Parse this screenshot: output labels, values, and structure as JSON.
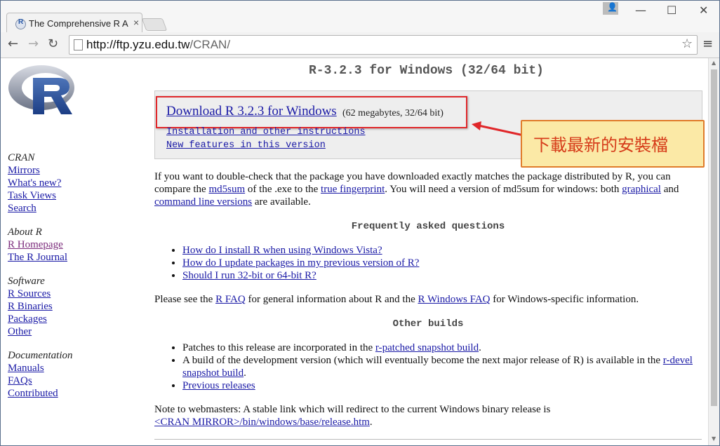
{
  "browser": {
    "tab_title": "The Comprehensive R Ar",
    "tab_close": "×",
    "url_host": "http://ftp.yzu.edu.tw",
    "url_path": "/CRAN/",
    "back": "←",
    "forward": "→",
    "reload": "↻",
    "star": "☆",
    "menu": "≡",
    "win_user": "👤",
    "win_min": "—",
    "win_max": "☐",
    "win_close": "✕"
  },
  "sidebar": {
    "cran_head": "CRAN",
    "cran_links": [
      "Mirrors",
      "What's new?",
      "Task Views",
      "Search"
    ],
    "about_head": "About R",
    "about_links": [
      "R Homepage",
      "The R Journal"
    ],
    "software_head": "Software",
    "software_links": [
      "R Sources",
      "R Binaries",
      "Packages",
      "Other"
    ],
    "doc_head": "Documentation",
    "doc_links": [
      "Manuals",
      "FAQs",
      "Contributed"
    ]
  },
  "main": {
    "title": "R-3.2.3 for Windows (32/64 bit)",
    "download_link": "Download R 3.2.3 for Windows",
    "download_size": "(62 megabytes, 32/64 bit)",
    "install_link": "Installation and other instructions",
    "features_link": "New features in this version",
    "callout": "下載最新的安裝檔",
    "p1_a": "If you want to double-check that the package you have downloaded exactly matches the package distributed by R, you can compare the ",
    "p1_md5": "md5sum",
    "p1_b": " of the .exe to the ",
    "p1_fp": "true fingerprint",
    "p1_c": ". You will need a version of md5sum for windows: both ",
    "p1_graphical": "graphical",
    "p1_d": " and ",
    "p1_cmd": "command line versions",
    "p1_e": " are available.",
    "faq_title": "Frequently asked questions",
    "faq_items": [
      "How do I install R when using Windows Vista?",
      "How do I update packages in my previous version of R?",
      "Should I run 32-bit or 64-bit R?"
    ],
    "p2_a": "Please see the ",
    "p2_rfaq": "R FAQ",
    "p2_b": " for general information about R and the ",
    "p2_wfaq": "R Windows FAQ",
    "p2_c": " for Windows-specific information.",
    "other_title": "Other builds",
    "ob1_a": "Patches to this release are incorporated in the ",
    "ob1_link": "r-patched snapshot build",
    "ob1_b": ".",
    "ob2_a": "A build of the development version (which will eventually become the next major release of R) is available in the ",
    "ob2_link": "r-devel snapshot build",
    "ob2_b": ".",
    "ob3_link": "Previous releases",
    "p3_a": "Note to webmasters: A stable link which will redirect to the current Windows binary release is",
    "p3_link": "<CRAN MIRROR>/bin/windows/base/release.htm",
    "p3_b": "."
  }
}
